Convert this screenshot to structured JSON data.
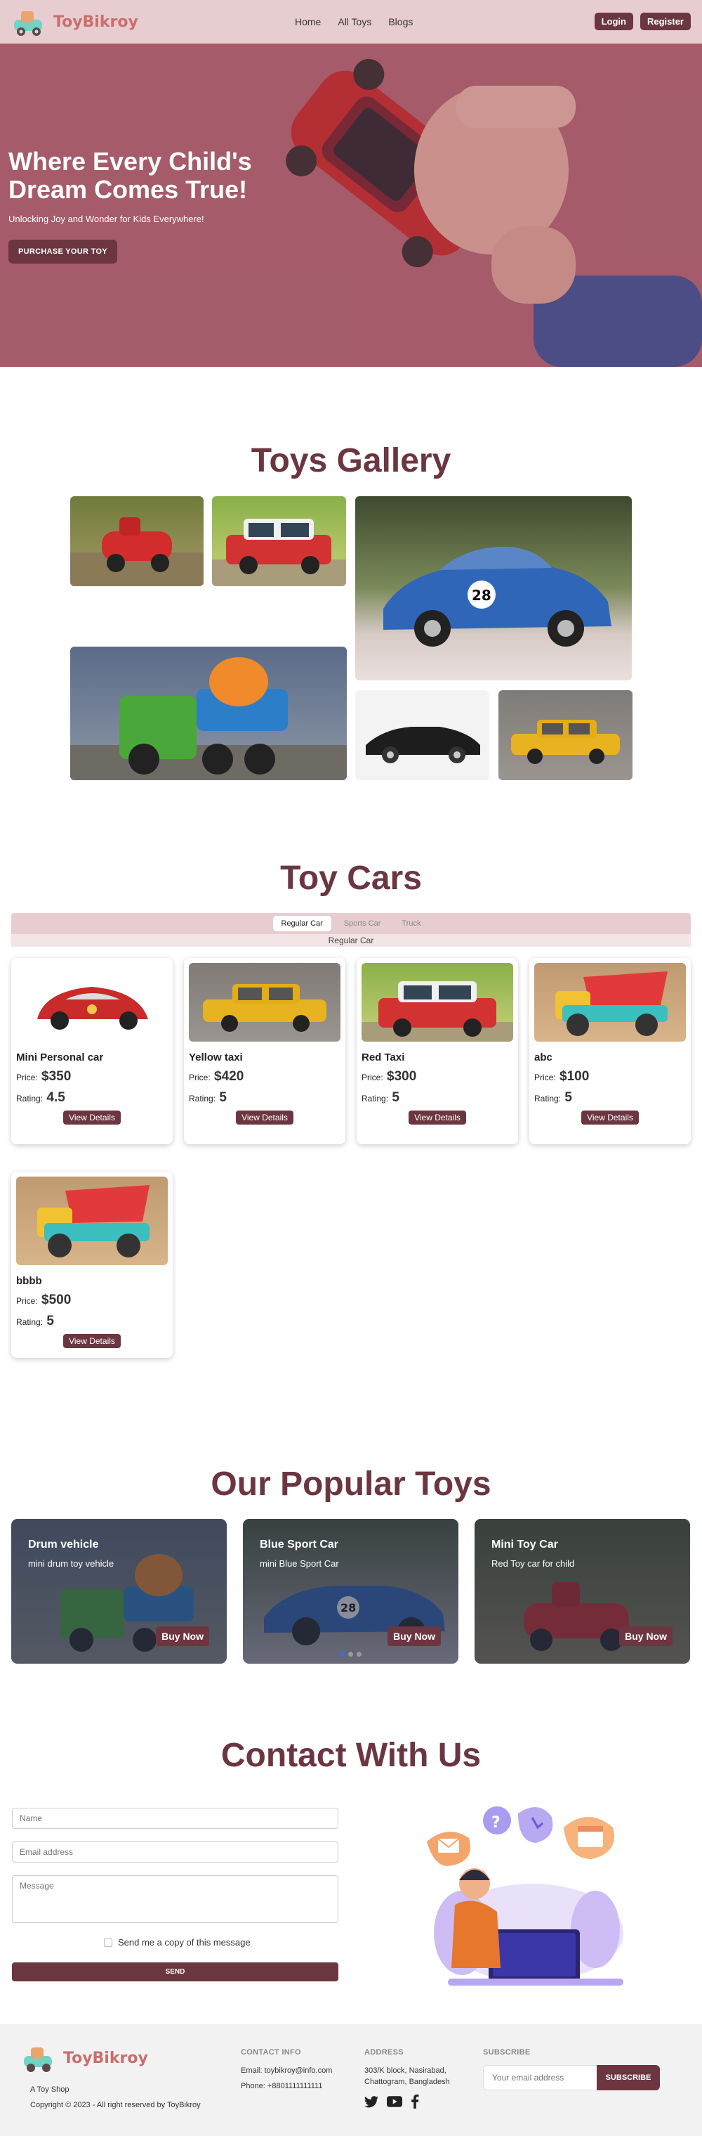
{
  "nav": {
    "brand": "ToyBikroy",
    "links": [
      "Home",
      "All Toys",
      "Blogs"
    ],
    "login": "Login",
    "register": "Register"
  },
  "hero": {
    "title": "Where Every Child's Dream Comes True!",
    "subtitle": "Unlocking Joy and Wonder for Kids Everywhere!",
    "button": "PURCHASE YOUR TOY"
  },
  "gallery": {
    "title": "Toys Gallery"
  },
  "toy_cars": {
    "title": "Toy Cars",
    "tabs": [
      "Regular Car",
      "Sports Car",
      "Truck"
    ],
    "active_tab_caption": "Regular Car",
    "price_label": "Price:",
    "rating_label": "Rating:",
    "details_label": "View Details",
    "cards": [
      {
        "name": "Mini Personal car",
        "price": "$350",
        "rating": "4.5"
      },
      {
        "name": "Yellow taxi",
        "price": "$420",
        "rating": "5"
      },
      {
        "name": "Red Taxi",
        "price": "$300",
        "rating": "5"
      },
      {
        "name": "abc",
        "price": "$100",
        "rating": "5"
      },
      {
        "name": "bbbb",
        "price": "$500",
        "rating": "5"
      }
    ]
  },
  "popular": {
    "title": "Our Popular Toys",
    "buy_label": "Buy Now",
    "items": [
      {
        "name": "Drum vehicle",
        "desc": "mini drum toy vehicle"
      },
      {
        "name": "Blue Sport Car",
        "desc": "mini Blue Sport Car"
      },
      {
        "name": "Mini Toy Car",
        "desc": "Red Toy car for child"
      }
    ]
  },
  "contact": {
    "title": "Contact With Us",
    "name_placeholder": "Name",
    "email_placeholder": "Email address",
    "message_placeholder": "Message",
    "copy_label": "Send me a copy of this message",
    "send": "SEND"
  },
  "footer": {
    "brand": "ToyBikroy",
    "tagline": "A Toy Shop",
    "copyright": "Copyright © 2023 - All right reserved by ToyBikroy",
    "contact_heading": "CONTACT INFO",
    "email": "Email: toybikroy@info.com",
    "phone": "Phone: +8801111111111",
    "address_heading": "ADDRESS",
    "address_line1": "303/K block, Nasirabad,",
    "address_line2": "Chattogram, Bangladesh",
    "subscribe_heading": "SUBSCRIBE",
    "subscribe_placeholder": "Your email address",
    "subscribe_button": "SUBSCRIBE"
  },
  "colors": {
    "brand": "#6b3640",
    "nav_bg": "#e7cdd0",
    "logo_text": "#c96e6e"
  }
}
